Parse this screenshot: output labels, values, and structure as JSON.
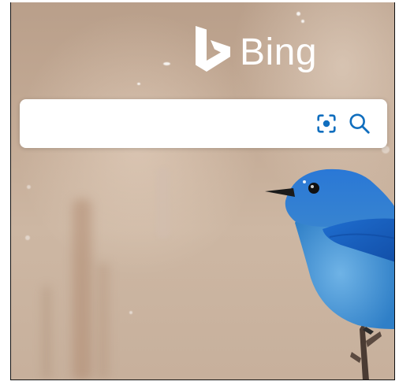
{
  "brand": {
    "name": "Bing",
    "logo_icon": "bing-b-logo-icon",
    "text_color": "#ffffff"
  },
  "search": {
    "value": "",
    "placeholder": "",
    "visual_search_icon": "visual-search-icon",
    "search_icon": "magnifier-icon",
    "accent_color": "#106ebe"
  }
}
